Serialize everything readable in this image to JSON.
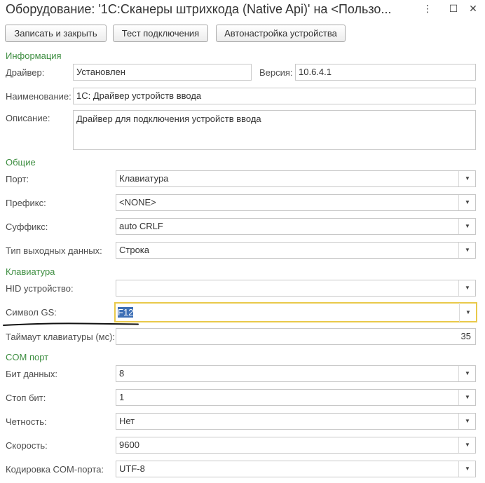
{
  "window": {
    "title": "Оборудование: '1С:Сканеры штрихкода (Native Api)' на <Пользо...",
    "more_label": "⋮",
    "maximize_label": "☐",
    "close_label": "✕"
  },
  "toolbar": {
    "save_close_label": "Записать и закрыть",
    "test_connection_label": "Тест подключения",
    "autoconfig_label": "Автонастройка устройства"
  },
  "info": {
    "section_label": "Информация",
    "driver_label": "Драйвер:",
    "driver_value": "Установлен",
    "version_label": "Версия:",
    "version_value": "10.6.4.1",
    "name_label": "Наименование:",
    "name_value": "1С: Драйвер устройств ввода",
    "description_label": "Описание:",
    "description_value": "Драйвер для подключения устройств ввода"
  },
  "general": {
    "section_label": "Общие",
    "port_label": "Порт:",
    "port_value": "Клавиатура",
    "prefix_label": "Префикс:",
    "prefix_value": "<NONE>",
    "suffix_label": "Суффикс:",
    "suffix_value": "auto CRLF",
    "output_type_label": "Тип выходных данных:",
    "output_type_value": "Строка"
  },
  "keyboard": {
    "section_label": "Клавиатура",
    "hid_label": "HID устройство:",
    "hid_value": "",
    "gs_label": "Символ GS:",
    "gs_value": "F12",
    "timeout_label": "Таймаут клавиатуры (мс):",
    "timeout_value": "35"
  },
  "com": {
    "section_label": "COM порт",
    "data_bits_label": "Бит данных:",
    "data_bits_value": "8",
    "stop_bits_label": "Стоп бит:",
    "stop_bits_value": "1",
    "parity_label": "Четность:",
    "parity_value": "Нет",
    "speed_label": "Скорость:",
    "speed_value": "9600",
    "encoding_label": "Кодировка COM-порта:",
    "encoding_value": "UTF-8"
  },
  "icons": {
    "dropdown": "▼"
  },
  "colors": {
    "section": "#3e8e41",
    "focus_border": "#e9c94a",
    "selection": "#3d6fb6"
  }
}
